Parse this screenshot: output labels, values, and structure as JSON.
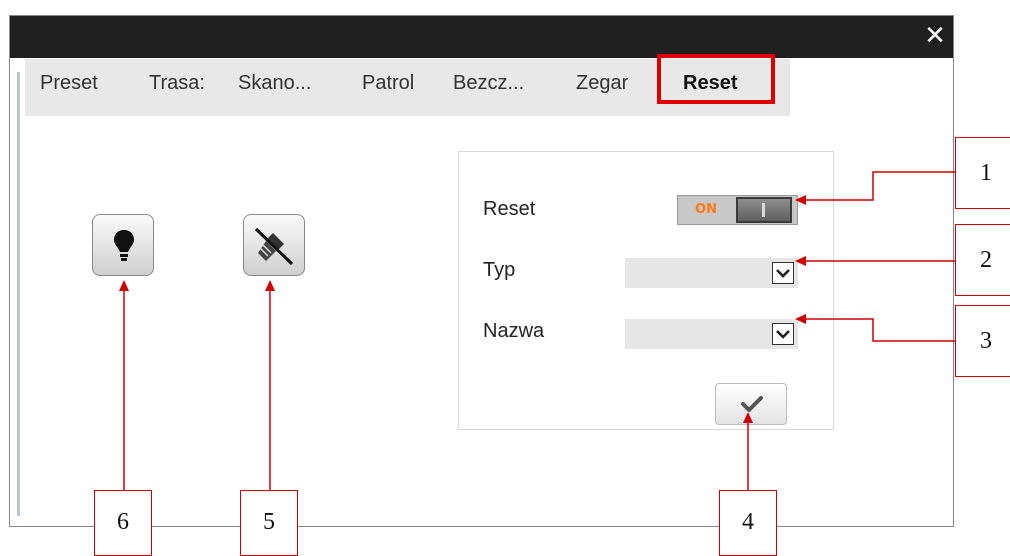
{
  "window": {
    "close_glyph": "✕"
  },
  "tabs": [
    {
      "label": "Preset"
    },
    {
      "label": "Trasa:"
    },
    {
      "label": "Skano..."
    },
    {
      "label": "Patrol"
    },
    {
      "label": "Bezcz..."
    },
    {
      "label": "Zegar"
    },
    {
      "label": "Reset",
      "active": true
    }
  ],
  "left_buttons": [
    {
      "icon": "light-bulb-icon"
    },
    {
      "icon": "wiper-off-icon"
    }
  ],
  "reset_panel": {
    "reset_label": "Reset",
    "toggle_text": "ON",
    "type_label": "Typ",
    "type_value": "",
    "name_label": "Nazwa",
    "name_value": "",
    "confirm_icon": "checkmark-icon"
  },
  "callouts": [
    "1",
    "2",
    "3",
    "4",
    "5",
    "6"
  ],
  "colors": {
    "title_bar": "#202020",
    "tab_strip": "#e8e8e8",
    "highlight": "#e00000",
    "toggle_on_text": "#ff7a14"
  }
}
